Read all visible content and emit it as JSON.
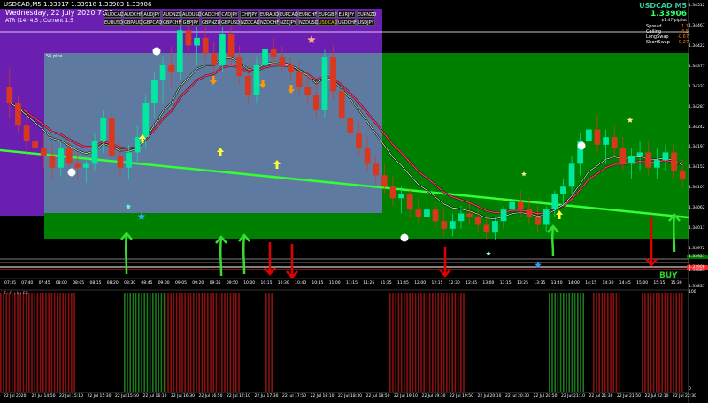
{
  "header": {
    "chart_title": "USDCAD,M5  1.33917 1.33918 1.33903 1.33906",
    "datetime": "Wednesday, 22 July 2020  7:30",
    "atr": "ATR (14) 4.5 ; Current 1.5"
  },
  "symbol_buttons": {
    "row1": [
      "AUDCAD",
      "AUDCHF",
      "AUDJPY",
      "AUDNZD",
      "AUDUSD",
      "CADCHF",
      "CADJPY",
      "CHFJPY",
      "EURAUD",
      "EURCAD",
      "EURCHF",
      "EURGBP",
      "EURJPY",
      "EURNZD"
    ],
    "row2": [
      "EURUSD",
      "GBPAUD",
      "GBPCAD",
      "GBPCHF",
      "GBPJPY",
      "GBPNZD",
      "GBPUSD",
      "NZDCAD",
      "NZDCHF",
      "NZDJPY",
      "NZDUSD",
      "USDCAD",
      "USDCHF",
      "USDJPY"
    ],
    "active": "USDCAD"
  },
  "panel": {
    "symbol": "USDCAD M5",
    "price": "1.33906",
    "per_pip": "$1.47/pip/lot",
    "rows": [
      {
        "label": "Spread",
        "value": "1.1"
      },
      {
        "label": "Ceiling",
        "value": "4.5"
      },
      {
        "label": "LongSwap",
        "value": "-0.67"
      },
      {
        "label": "ShortSwap",
        "value": "-0.27"
      }
    ]
  },
  "zone_label": "56 pips",
  "signal": "BUY",
  "indicator_label": "T ; R ; I; ; EX",
  "price_axis": [
    "1.34512",
    "1.34467",
    "1.34422",
    "1.34377",
    "1.34332",
    "1.34287",
    "1.34242",
    "1.34197",
    "1.34152",
    "1.34107",
    "1.34062",
    "1.34017",
    "1.33972",
    "1.33927",
    "1.33906",
    "1.33883",
    "1.33837"
  ],
  "indicator_axis": [
    "100",
    "0"
  ],
  "time_axis": [
    "07:35",
    "07:40",
    "07:45",
    "08:00",
    "08:05",
    "08:15",
    "08:20",
    "08:30",
    "08:45",
    "09:00",
    "09:05",
    "09:20",
    "09:35",
    "09:50",
    "10:00",
    "10:15",
    "10:30",
    "10:40",
    "10:45",
    "11:00",
    "11:15",
    "11:25",
    "11:35",
    "11:45",
    "12:00",
    "12:15",
    "12:30",
    "12:45",
    "13:00",
    "13:15",
    "13:25",
    "13:35",
    "13:40",
    "14:00",
    "14:15",
    "14:30",
    "14:45",
    "15:00",
    "15:15",
    "15:30"
  ],
  "bottom_axis": [
    "22 Jul 2020",
    "22 Jul 14:50",
    "22 Jul 15:10",
    "22 Jul 15:30",
    "22 Jul 15:50",
    "22 Jul 16:10",
    "22 Jul 16:30",
    "22 Jul 16:50",
    "22 Jul 17:10",
    "22 Jul 17:30",
    "22 Jul 17:50",
    "22 Jul 18:10",
    "22 Jul 18:30",
    "22 Jul 18:50",
    "22 Jul 19:10",
    "22 Jul 19:30",
    "22 Jul 19:50",
    "22 Jul 20:10",
    "22 Jul 20:30",
    "22 Jul 20:50",
    "22 Jul 21:10",
    "22 Jul 21:30",
    "22 Jul 21:50",
    "22 Jul 22:10",
    "22 Jul 22:30"
  ],
  "colors": {
    "purple_zone": "#6a1fb0",
    "blue_zone": "#5e7aa0",
    "green_zone": "#008000",
    "bull_candle": "#00e8a0",
    "bear_candle": "#d9381e",
    "trend_line": "#33ff33",
    "ma_red": "#ff3366",
    "up_arrow": "#33dd33",
    "down_arrow": "#e00000",
    "yellow_arrow": "#ffff33",
    "orange_arrow": "#ff9900",
    "buy_text": "#33cc33"
  },
  "chart_data": {
    "type": "candlestick",
    "y_range": [
      1.3383,
      1.3452
    ],
    "candles": [
      [
        1.343,
        1.3435,
        1.3422,
        1.3426
      ],
      [
        1.3426,
        1.3428,
        1.3418,
        1.342
      ],
      [
        1.342,
        1.3424,
        1.3412,
        1.3416
      ],
      [
        1.3416,
        1.3419,
        1.341,
        1.3414
      ],
      [
        1.3414,
        1.3418,
        1.3409,
        1.3412
      ],
      [
        1.3412,
        1.3415,
        1.3406,
        1.3409
      ],
      [
        1.3409,
        1.3416,
        1.3407,
        1.3414
      ],
      [
        1.3414,
        1.3417,
        1.3409,
        1.341
      ],
      [
        1.341,
        1.3413,
        1.3406,
        1.3409
      ],
      [
        1.3409,
        1.3412,
        1.3405,
        1.341
      ],
      [
        1.341,
        1.3418,
        1.3408,
        1.3416
      ],
      [
        1.3416,
        1.3424,
        1.3413,
        1.3422
      ],
      [
        1.3422,
        1.3424,
        1.341,
        1.3412
      ],
      [
        1.3412,
        1.3416,
        1.3407,
        1.3409
      ],
      [
        1.3409,
        1.3415,
        1.3406,
        1.3413
      ],
      [
        1.3413,
        1.342,
        1.341,
        1.3417
      ],
      [
        1.3417,
        1.3428,
        1.3414,
        1.3426
      ],
      [
        1.3426,
        1.3434,
        1.3422,
        1.3432
      ],
      [
        1.3432,
        1.3438,
        1.3426,
        1.3436
      ],
      [
        1.3436,
        1.3441,
        1.343,
        1.3434
      ],
      [
        1.3434,
        1.3447,
        1.3432,
        1.3445
      ],
      [
        1.3445,
        1.3449,
        1.3438,
        1.3441
      ],
      [
        1.3441,
        1.3446,
        1.3436,
        1.3443
      ],
      [
        1.3443,
        1.3446,
        1.3437,
        1.3439
      ],
      [
        1.3439,
        1.3442,
        1.3434,
        1.3436
      ],
      [
        1.3436,
        1.3446,
        1.3434,
        1.3444
      ],
      [
        1.3444,
        1.3447,
        1.3436,
        1.3438
      ],
      [
        1.3438,
        1.3441,
        1.3431,
        1.3433
      ],
      [
        1.3433,
        1.3436,
        1.3426,
        1.3428
      ],
      [
        1.3428,
        1.3438,
        1.3426,
        1.3436
      ],
      [
        1.3436,
        1.3442,
        1.3433,
        1.344
      ],
      [
        1.344,
        1.3443,
        1.3436,
        1.3438
      ],
      [
        1.3438,
        1.3441,
        1.3434,
        1.3436
      ],
      [
        1.3436,
        1.3438,
        1.3432,
        1.3434
      ],
      [
        1.3434,
        1.3437,
        1.3428,
        1.343
      ],
      [
        1.343,
        1.3434,
        1.3426,
        1.3428
      ],
      [
        1.3428,
        1.3432,
        1.3422,
        1.3424
      ],
      [
        1.3424,
        1.344,
        1.3422,
        1.3438
      ],
      [
        1.3438,
        1.3441,
        1.3427,
        1.3429
      ],
      [
        1.3429,
        1.3432,
        1.342,
        1.3422
      ],
      [
        1.3422,
        1.3425,
        1.3416,
        1.3418
      ],
      [
        1.3418,
        1.3421,
        1.3412,
        1.3414
      ],
      [
        1.3414,
        1.3417,
        1.3408,
        1.341
      ],
      [
        1.341,
        1.3412,
        1.3405,
        1.3407
      ],
      [
        1.3407,
        1.341,
        1.3402,
        1.3404
      ],
      [
        1.3404,
        1.3407,
        1.3399,
        1.3401
      ],
      [
        1.3401,
        1.3404,
        1.3397,
        1.3402
      ],
      [
        1.3402,
        1.3404,
        1.3396,
        1.3398
      ],
      [
        1.3398,
        1.3401,
        1.3394,
        1.3396
      ],
      [
        1.3396,
        1.34,
        1.3393,
        1.3398
      ],
      [
        1.3398,
        1.34,
        1.3393,
        1.3395
      ],
      [
        1.3395,
        1.3398,
        1.3391,
        1.3393
      ],
      [
        1.3393,
        1.3397,
        1.3391,
        1.3395
      ],
      [
        1.3395,
        1.3399,
        1.3393,
        1.3397
      ],
      [
        1.3397,
        1.34,
        1.3394,
        1.3396
      ],
      [
        1.3396,
        1.3398,
        1.3392,
        1.3394
      ],
      [
        1.3394,
        1.3396,
        1.339,
        1.3392
      ],
      [
        1.3392,
        1.3396,
        1.339,
        1.3395
      ],
      [
        1.3395,
        1.3399,
        1.3393,
        1.3398
      ],
      [
        1.3398,
        1.3401,
        1.3395,
        1.34
      ],
      [
        1.34,
        1.3403,
        1.3396,
        1.3398
      ],
      [
        1.3398,
        1.3401,
        1.3394,
        1.3396
      ],
      [
        1.3396,
        1.3399,
        1.3392,
        1.3394
      ],
      [
        1.3394,
        1.3399,
        1.3392,
        1.3398
      ],
      [
        1.3398,
        1.3403,
        1.3396,
        1.3402
      ],
      [
        1.3402,
        1.3406,
        1.3399,
        1.3404
      ],
      [
        1.3404,
        1.3412,
        1.3402,
        1.341
      ],
      [
        1.341,
        1.3418,
        1.3407,
        1.3416
      ],
      [
        1.3416,
        1.3421,
        1.3412,
        1.3419
      ],
      [
        1.3419,
        1.3423,
        1.3413,
        1.3415
      ],
      [
        1.3415,
        1.3419,
        1.341,
        1.3417
      ],
      [
        1.3417,
        1.342,
        1.3412,
        1.3414
      ],
      [
        1.3414,
        1.3417,
        1.3408,
        1.341
      ],
      [
        1.341,
        1.3414,
        1.3406,
        1.3412
      ],
      [
        1.3412,
        1.3416,
        1.3408,
        1.3413
      ],
      [
        1.3413,
        1.3416,
        1.3407,
        1.3409
      ],
      [
        1.3409,
        1.3414,
        1.3406,
        1.3411
      ],
      [
        1.3411,
        1.3415,
        1.3408,
        1.3413
      ],
      [
        1.3413,
        1.3415,
        1.3406,
        1.3408
      ],
      [
        1.3408,
        1.3411,
        1.3404,
        1.3406
      ]
    ]
  }
}
